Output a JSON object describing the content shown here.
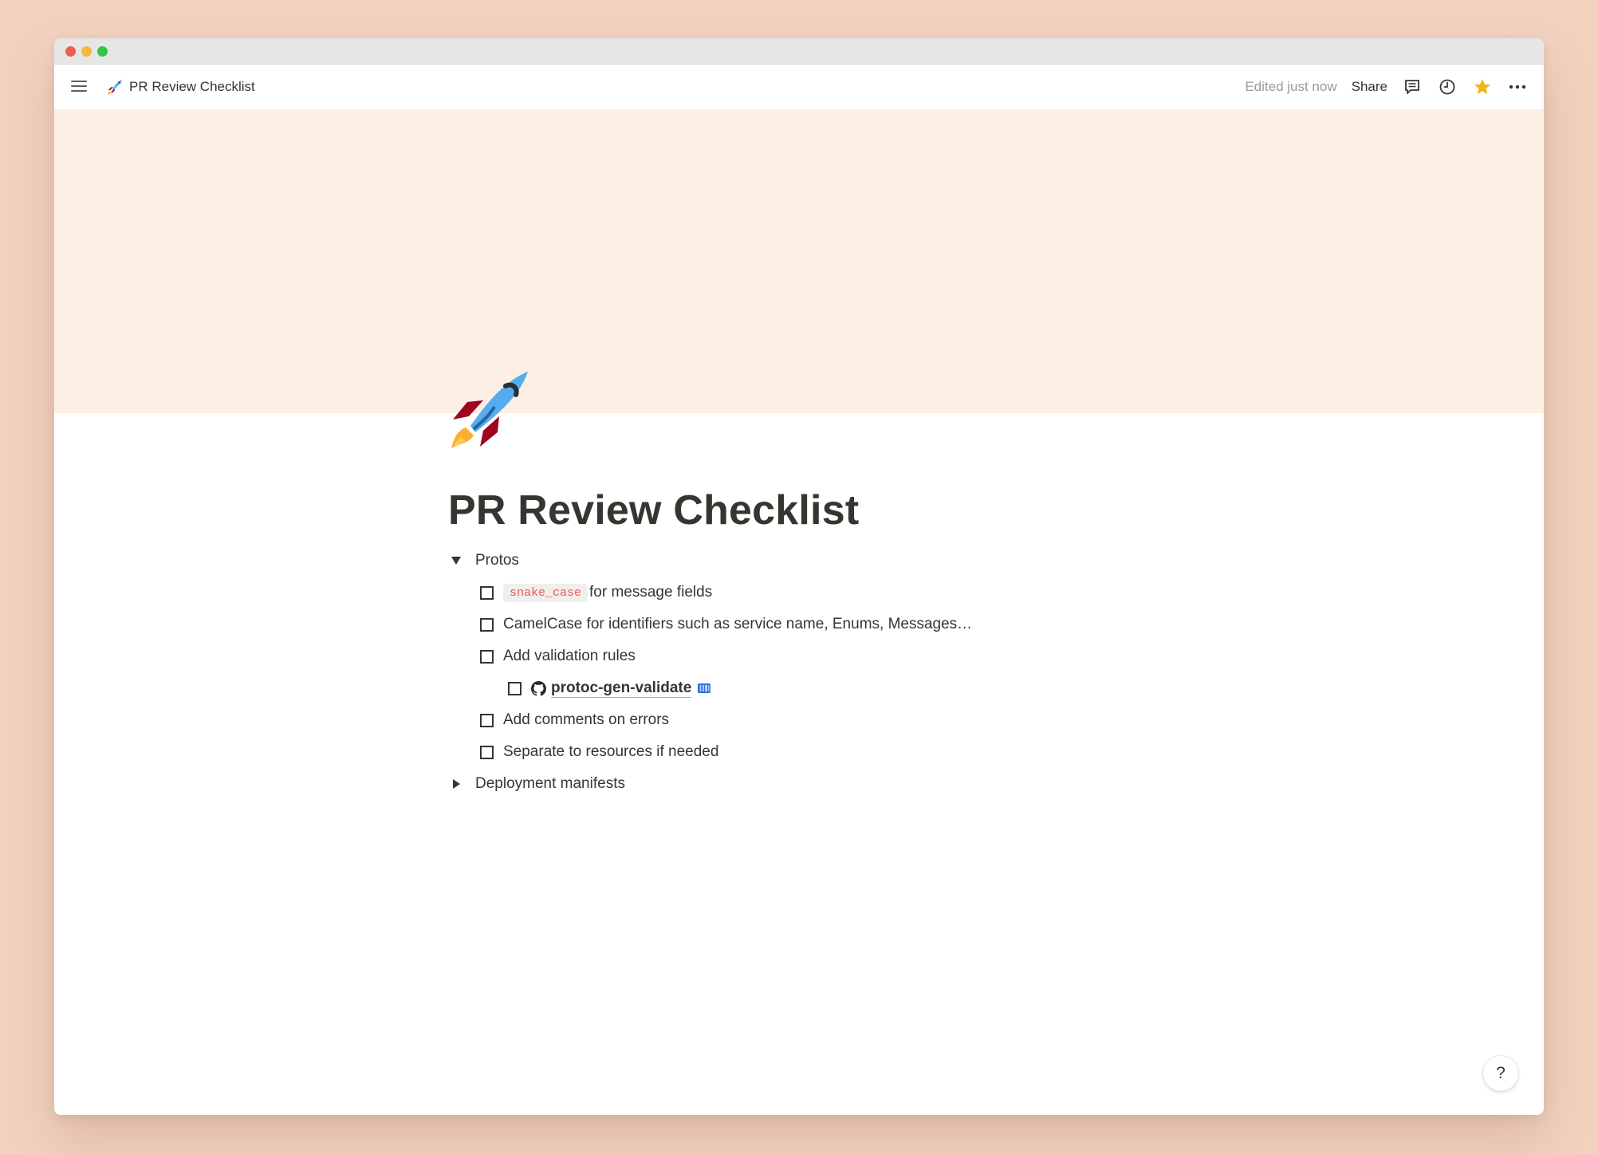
{
  "window": {
    "controls": [
      {
        "name": "close",
        "color": "#ee5d55"
      },
      {
        "name": "minimize",
        "color": "#f5b83a"
      },
      {
        "name": "maximize",
        "color": "#36c446"
      }
    ]
  },
  "topbar": {
    "page_icon": "rocket-icon",
    "page_title": "PR Review Checklist",
    "edited_status": "Edited just now",
    "share_label": "Share",
    "actions": [
      "comment-icon",
      "clock-icon",
      "star-icon",
      "more-icon"
    ],
    "star_color": "#f2b51a"
  },
  "page": {
    "cover_color": "#feefe4",
    "icon": "rocket-icon",
    "title": "PR Review Checklist",
    "blocks": [
      {
        "type": "toggle",
        "expanded": true,
        "label": "Protos",
        "children": [
          {
            "type": "todo",
            "checked": false,
            "code": "snake_case",
            "text": "for message fields"
          },
          {
            "type": "todo",
            "checked": false,
            "text": "CamelCase for identifiers such as service name, Enums, Messages…"
          },
          {
            "type": "todo",
            "checked": false,
            "text": "Add validation rules",
            "children": [
              {
                "type": "todo",
                "checked": false,
                "link_icon": "github-icon",
                "link_text": "protoc-gen-validate",
                "trail_icon": "notion-badge-icon"
              }
            ]
          },
          {
            "type": "todo",
            "checked": false,
            "text": "Add comments on errors"
          },
          {
            "type": "todo",
            "checked": false,
            "text": "Separate to resources if needed"
          }
        ]
      },
      {
        "type": "toggle",
        "expanded": false,
        "label": "Deployment manifests"
      }
    ]
  },
  "help": {
    "label": "?"
  }
}
